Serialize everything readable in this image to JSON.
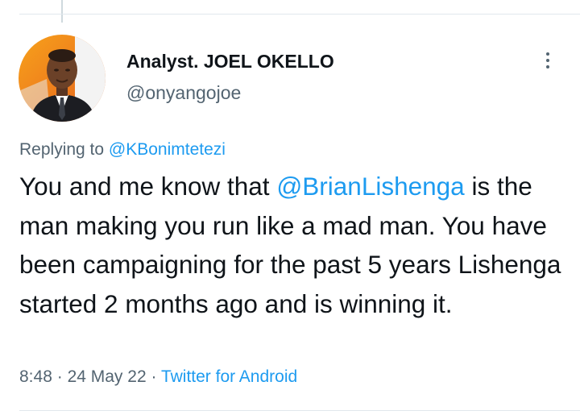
{
  "tweet": {
    "author": {
      "display_name": "Analyst. JOEL OKELLO",
      "handle": "@onyangojoe",
      "avatar_icon": "profile-photo"
    },
    "more_icon": "more-vertical-icon",
    "replying": {
      "prefix": "Replying to",
      "mention": "@KBonimtetezi"
    },
    "body": {
      "before_mention": "You and me know that ",
      "mention": "@BrianLishenga",
      "after_mention": " is the man making you run like a mad man. You have been campaigning for the past 5 years Lishenga started 2 months ago and is winning it."
    },
    "meta": {
      "time": "8:48",
      "separator": "·",
      "date": "24 May 22",
      "source": "Twitter for Android"
    }
  },
  "colors": {
    "text": "#0f1419",
    "secondary": "#536471",
    "link": "#1d9bf0",
    "divider": "#e1e8ed"
  }
}
